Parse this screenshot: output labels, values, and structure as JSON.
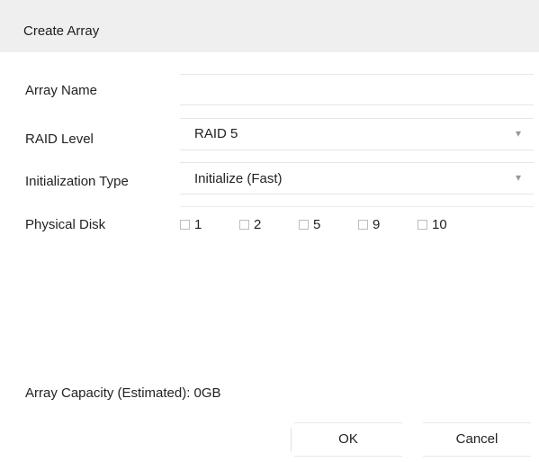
{
  "dialog": {
    "title": "Create Array"
  },
  "form": {
    "array_name": {
      "label": "Array Name",
      "value": ""
    },
    "raid_level": {
      "label": "RAID Level",
      "value": "RAID 5"
    },
    "initialization_type": {
      "label": "Initialization Type",
      "value": "Initialize (Fast)"
    },
    "physical_disk": {
      "label": "Physical Disk",
      "disks": [
        {
          "label": "1",
          "checked": false
        },
        {
          "label": "2",
          "checked": false
        },
        {
          "label": "5",
          "checked": false
        },
        {
          "label": "9",
          "checked": false
        },
        {
          "label": "10",
          "checked": false
        }
      ]
    }
  },
  "capacity": {
    "text": "Array Capacity (Estimated): 0GB"
  },
  "buttons": {
    "ok": "OK",
    "cancel": "Cancel"
  },
  "icons": {
    "dropdown": "chevron-down-icon",
    "checkbox": "checkbox-icon"
  }
}
